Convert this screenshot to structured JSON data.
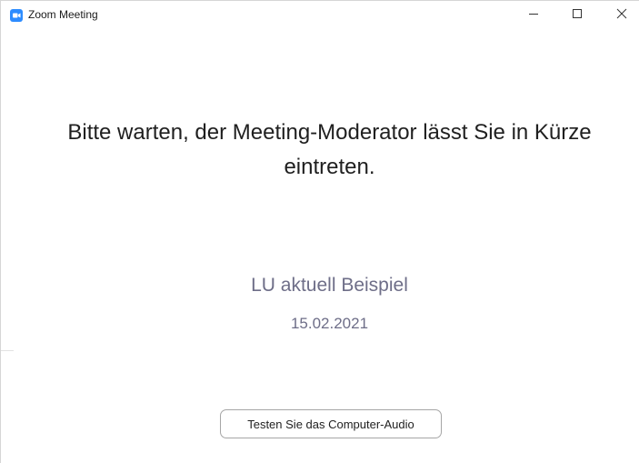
{
  "window": {
    "title": "Zoom Meeting",
    "controls": {
      "minimize": "minimize-icon",
      "maximize": "maximize-icon",
      "close": "close-icon"
    },
    "app_icon": "zoom-camera-icon",
    "accent_color": "#2d8cff"
  },
  "main": {
    "waiting_message": "Bitte warten, der Meeting-Moderator lässt Sie in Kürze eintreten.",
    "meeting_title": "LU aktuell Beispiel",
    "meeting_date": "15.02.2021",
    "audio_test_button": "Testen Sie das Computer-Audio"
  }
}
